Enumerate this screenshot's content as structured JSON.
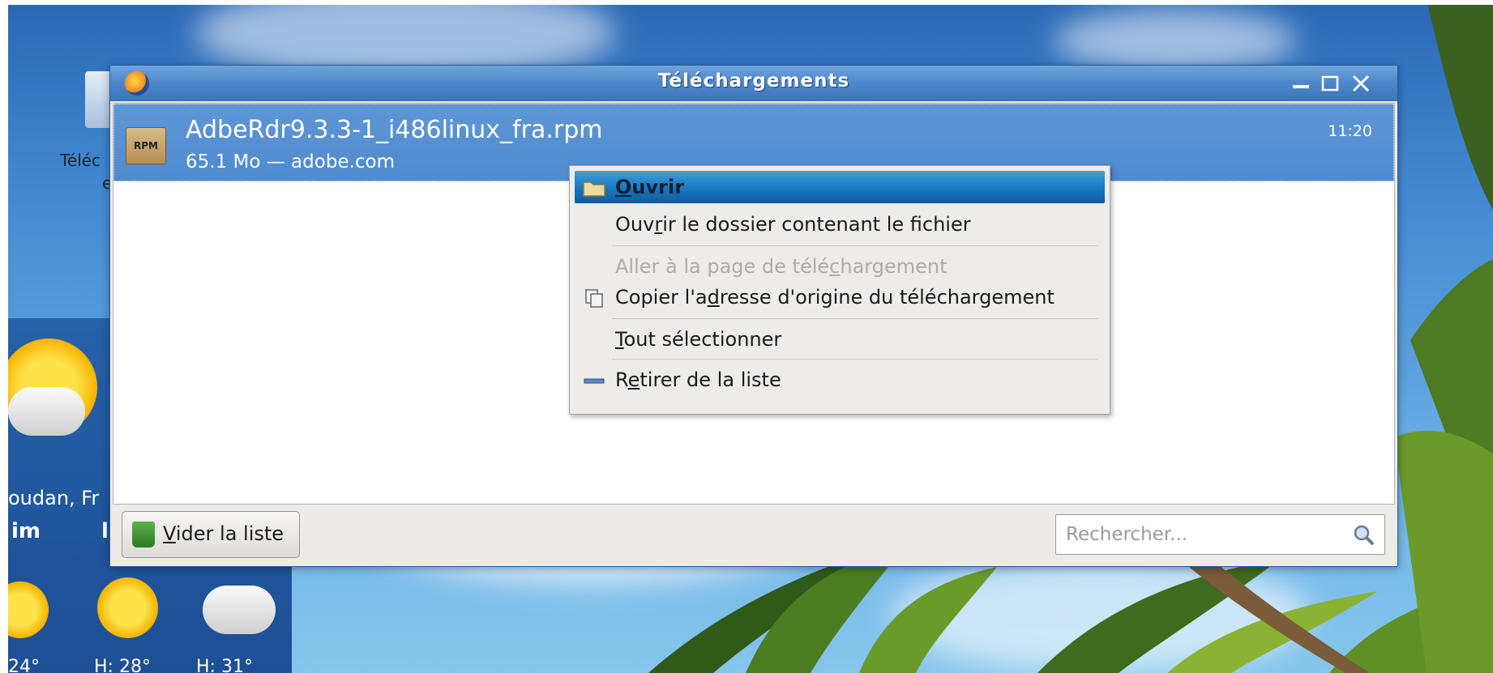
{
  "desktop": {
    "icon_label": "Téléc",
    "icon_label_cut": "e",
    "weather": {
      "city": "oudan, Fr",
      "day_label": "im",
      "day_label2": "l",
      "temps": [
        "24°",
        "H: 28°",
        "H: 31°"
      ]
    }
  },
  "window": {
    "title": "Téléchargements",
    "controls": [
      "minimize",
      "maximize",
      "close"
    ],
    "download": {
      "filename": "AdbeRdr9.3.3-1_i486linux_fra.rpm",
      "meta": "65.1 Mo — adobe.com",
      "time": "11:20",
      "icon_text": "RPM"
    },
    "clear_button": {
      "underlined": "V",
      "rest": "ider la liste"
    },
    "search": {
      "placeholder": "Rechercher..."
    }
  },
  "context_menu": {
    "items": [
      {
        "pre": "",
        "u": "O",
        "post": "uvrir",
        "state": "highlighted",
        "icon": "folder-icon"
      },
      {
        "pre": "Ouv",
        "u": "r",
        "post": "ir le dossier contenant le fichier",
        "state": "normal",
        "icon": ""
      },
      {
        "pre": "Aller à la page de télé",
        "u": "c",
        "post": "hargement",
        "state": "disabled",
        "icon": ""
      },
      {
        "pre": "Copier l'a",
        "u": "d",
        "post": "resse d'origine du téléchargement",
        "state": "normal",
        "icon": "copy-icon"
      },
      {
        "pre": "",
        "u": "T",
        "post": "out sélectionner",
        "state": "normal",
        "icon": ""
      },
      {
        "pre": "R",
        "u": "e",
        "post": "tirer de la liste",
        "state": "normal",
        "icon": "remove-icon"
      }
    ]
  },
  "colors": {
    "titlebar": "#4d86c9",
    "selection": "#5690d3",
    "menu_highlight": "#1778c0"
  }
}
